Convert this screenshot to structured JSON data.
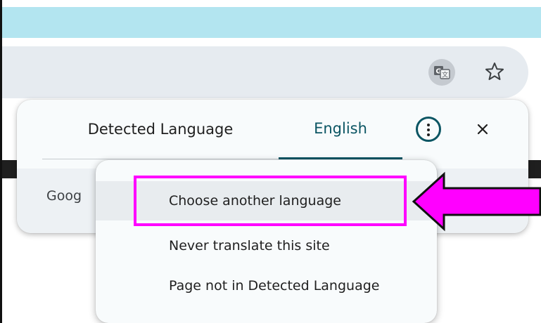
{
  "colors": {
    "banner": "#b3e5f0",
    "address_bar": "#e6ebf0",
    "accent": "#0b5563",
    "highlight": "#ff00ff",
    "popup_bg": "#f8fbfc"
  },
  "browser": {
    "translate_icon": "translate-icon",
    "bookmark_icon": "star-icon"
  },
  "translate_popup": {
    "tabs": [
      {
        "label": "Detected Language",
        "selected": false
      },
      {
        "label": "English",
        "selected": true
      }
    ],
    "more_icon": "more-options-icon",
    "close_icon": "close-icon",
    "footer_text": "Goog"
  },
  "options_menu": {
    "items": [
      {
        "label": "Choose another language",
        "highlighted": true
      },
      {
        "label": "Never translate this site",
        "highlighted": false
      },
      {
        "label": "Page not in Detected Language",
        "highlighted": false
      }
    ]
  },
  "annotation": {
    "arrow_icon": "pointer-arrow-icon",
    "highlight_target": "Choose another language"
  }
}
